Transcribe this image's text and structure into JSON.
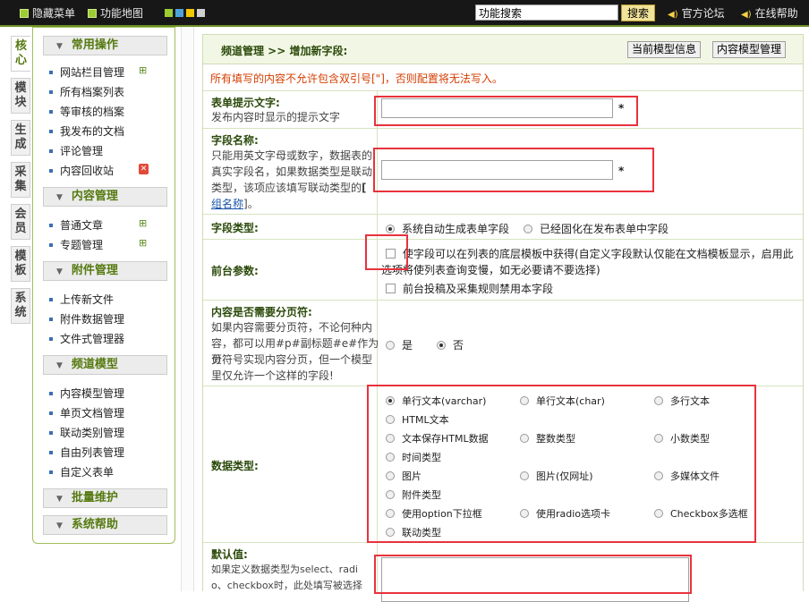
{
  "topbar": {
    "hide_menu": "隐藏菜单",
    "func_map": "功能地图",
    "search_value": "功能搜索",
    "search_btn": "搜索",
    "forum": "官方论坛",
    "help": "在线帮助",
    "colors": [
      "#9ccc33",
      "#4da3d8",
      "#f0c800",
      "#d0d0d0"
    ]
  },
  "left_tabs": [
    {
      "label": "核心"
    },
    {
      "label": "模块"
    },
    {
      "label": "生成"
    },
    {
      "label": "采集"
    },
    {
      "label": "会员"
    },
    {
      "label": "模板"
    },
    {
      "label": "系统"
    }
  ],
  "sidebar": {
    "sections": [
      {
        "title": "常用操作",
        "items": [
          "网站栏目管理",
          "所有档案列表",
          "等审核的档案",
          "我发布的文档",
          "评论管理",
          "内容回收站"
        ]
      },
      {
        "title": "内容管理",
        "items": [
          "普通文章",
          "专题管理"
        ]
      },
      {
        "title": "附件管理",
        "items": [
          "上传新文件",
          "附件数据管理",
          "文件式管理器"
        ]
      },
      {
        "title": "频道模型",
        "items": [
          "内容模型管理",
          "单页文档管理",
          "联动类别管理",
          "自由列表管理",
          "自定义表单"
        ]
      },
      {
        "title": "批量维护",
        "items": []
      },
      {
        "title": "系统帮助",
        "items": []
      }
    ]
  },
  "main": {
    "breadcrumb": "频道管理 >> 增加新字段:",
    "btn_model_info": "当前模型信息",
    "btn_model_manage": "内容模型管理",
    "warning": "所有填写的内容不允许包含双引号[\"]，否则配置将无法写入。",
    "form_tip": {
      "label": "表单提示文字:",
      "desc": "发布内容时显示的提示文字",
      "value": "",
      "star": "*"
    },
    "field_name": {
      "label": "字段名称:",
      "desc_lines": [
        "只能用英文字母或数字，数据表的",
        "真实字段名，如果数据类型是联动",
        "类型，该项应该填写联动类型的"
      ],
      "link_bracket": "[",
      "link_text": "组名称",
      "link_tail": "]。",
      "value": "",
      "star": "*"
    },
    "field_type": {
      "label": "字段类型:",
      "options": [
        "系统自动生成表单字段",
        "已经固化在发布表单中字段"
      ],
      "selected": 0
    },
    "front_params": {
      "label": "前台参数:",
      "cb1_line1": "使字段可以在列表的底层模板中获得(自定义字段默认仅能在文档模板显示，启用此",
      "cb1_line2": "选项将使列表查询变慢，如无必要请不要选择)",
      "cb2": "前台投稿及采集规则禁用本字段"
    },
    "paging": {
      "label": "内容是否需要分页符:",
      "desc_lines": [
        "如果内容需要分页符，不论何种内",
        "容，都可以用#p#副标题#e#作为分",
        "页符号实现内容分页，但一个模型",
        "里仅允许一个这样的字段!"
      ],
      "options": [
        "是",
        "否"
      ],
      "selected": 1
    },
    "data_type": {
      "label": "数据类型:",
      "options": [
        "单行文本(varchar)",
        "单行文本(char)",
        "多行文本",
        "HTML文本",
        "文本保存HTML数据",
        "整数类型",
        "小数类型",
        "时间类型",
        "图片",
        "图片(仅网址)",
        "多媒体文件",
        "附件类型",
        "使用option下拉框",
        "使用radio选项卡",
        "Checkbox多选框",
        "联动类型"
      ],
      "selected": 0
    },
    "default_value": {
      "label": "默认值:",
      "desc_lines": [
        "如果定义数据类型为select、radi",
        "o、checkbox时，此处填写被选择"
      ]
    }
  }
}
